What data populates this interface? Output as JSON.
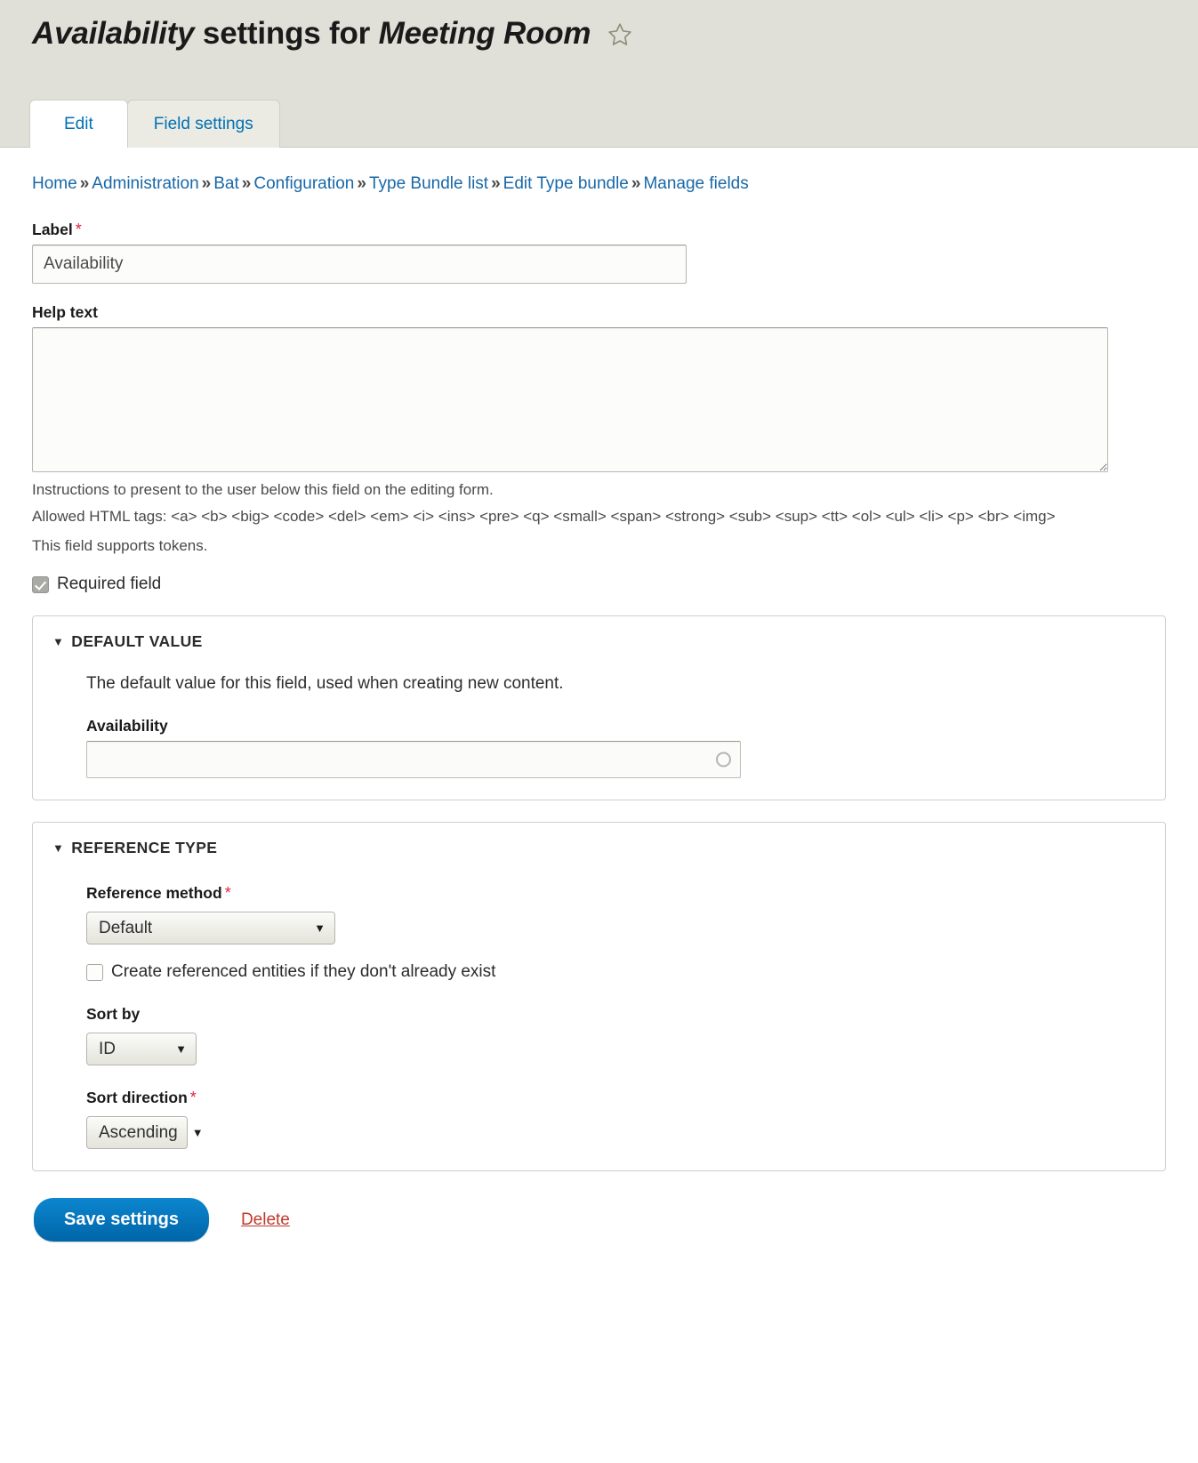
{
  "header": {
    "title_field": "Availability",
    "title_mid": " settings for ",
    "title_bundle": "Meeting Room",
    "star_icon": "star-outline-icon"
  },
  "tabs": [
    {
      "label": "Edit",
      "active": true
    },
    {
      "label": "Field settings",
      "active": false
    }
  ],
  "breadcrumb": {
    "separator": "»",
    "items": [
      "Home",
      "Administration",
      "Bat",
      "Configuration",
      "Type Bundle list",
      "Edit Type bundle",
      "Manage fields"
    ]
  },
  "form": {
    "label_field": {
      "label": "Label",
      "required_mark": "*",
      "value": "Availability",
      "placeholder": ""
    },
    "help_text": {
      "label": "Help text",
      "value": "",
      "placeholder": "",
      "description": "Instructions to present to the user below this field on the editing form.",
      "allowed_tags": "Allowed HTML tags: <a> <b> <big> <code> <del> <em> <i> <ins> <pre> <q> <small> <span> <strong> <sub> <sup> <tt> <ol> <ul> <li> <p> <br> <img>",
      "tokens_note": "This field supports tokens."
    },
    "required_field": {
      "label": "Required field",
      "checked": true
    },
    "default_value": {
      "legend": "DEFAULT VALUE",
      "caret": "▼",
      "description": "The default value for this field, used when creating new content.",
      "field_label": "Availability",
      "field_value": "",
      "field_placeholder": "",
      "throbber_icon": "loading-circle-icon"
    },
    "reference_type": {
      "legend": "REFERENCE TYPE",
      "caret": "▼",
      "reference_method": {
        "label": "Reference method",
        "required_mark": "*",
        "value": "Default",
        "arrow": "▼"
      },
      "create_entities": {
        "label": "Create referenced entities if they don't already exist",
        "checked": false
      },
      "sort_by": {
        "label": "Sort by",
        "value": "ID",
        "arrow": "▼"
      },
      "sort_direction": {
        "label": "Sort direction",
        "required_mark": "*",
        "value": "Ascending",
        "arrow": "▼"
      }
    }
  },
  "actions": {
    "save_label": "Save settings",
    "delete_label": "Delete"
  },
  "colors": {
    "link": "#1868a8",
    "required": "#e02443",
    "primary_button": "#0071b8",
    "delete_link": "#c0392b",
    "header_bg": "#e0e0d8"
  }
}
